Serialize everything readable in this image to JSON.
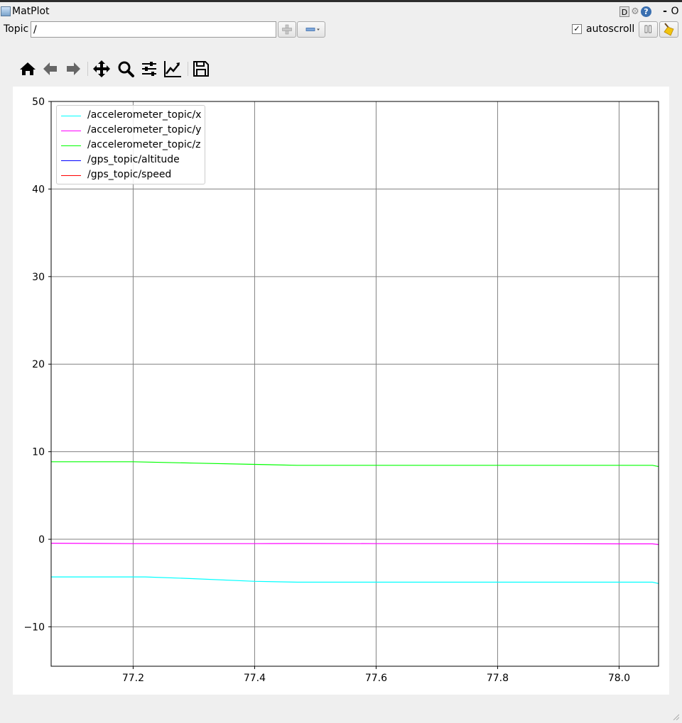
{
  "window": {
    "title": "MatPlot",
    "d_label": "D",
    "help_label": "?",
    "minimize_label": "-",
    "close_label": "O"
  },
  "topic": {
    "label": "Topic",
    "value": "/"
  },
  "autoscroll": {
    "label": "autoscroll",
    "checked": true,
    "check_glyph": "✓"
  },
  "toolbar_icons": [
    "home-icon",
    "back-icon",
    "forward-icon",
    "pan-icon",
    "zoom-icon",
    "configure-subplots-icon",
    "edit-axis-icon",
    "save-icon"
  ],
  "colors": {
    "accelerometer_x": "#00ffff",
    "accelerometer_y": "#ff00ff",
    "accelerometer_z": "#00ff00",
    "gps_altitude": "#0000ff",
    "gps_speed": "#ff0000",
    "grid": "#808080"
  },
  "chart_data": {
    "type": "line",
    "title": "",
    "xlabel": "",
    "ylabel": "",
    "xlim": [
      77.065,
      78.065
    ],
    "ylim": [
      -14.5,
      50
    ],
    "xticks": [
      77.2,
      77.4,
      77.6,
      77.8,
      78.0
    ],
    "xtick_labels": [
      "77.2",
      "77.4",
      "77.6",
      "77.8",
      "78.0"
    ],
    "yticks": [
      -10,
      0,
      10,
      20,
      30,
      40,
      50
    ],
    "ytick_labels": [
      "−10",
      "0",
      "10",
      "20",
      "30",
      "40",
      "50"
    ],
    "grid": true,
    "legend_position": "upper-left",
    "series": [
      {
        "name": "/accelerometer_topic/x",
        "color": "#00ffff",
        "x": [
          77.065,
          77.2,
          77.22,
          77.3,
          77.4,
          77.47,
          77.6,
          77.8,
          78.0,
          78.055,
          78.065
        ],
        "y": [
          -4.3,
          -4.3,
          -4.3,
          -4.5,
          -4.8,
          -4.9,
          -4.9,
          -4.9,
          -4.9,
          -4.9,
          -5.05
        ]
      },
      {
        "name": "/accelerometer_topic/y",
        "color": "#ff00ff",
        "x": [
          77.065,
          77.2,
          77.4,
          77.47,
          77.6,
          77.8,
          78.0,
          78.055,
          78.065
        ],
        "y": [
          -0.45,
          -0.5,
          -0.5,
          -0.48,
          -0.5,
          -0.5,
          -0.52,
          -0.52,
          -0.6
        ]
      },
      {
        "name": "/accelerometer_topic/z",
        "color": "#00ff00",
        "x": [
          77.065,
          77.2,
          77.3,
          77.4,
          77.47,
          77.6,
          77.8,
          78.0,
          78.055,
          78.065
        ],
        "y": [
          8.85,
          8.85,
          8.7,
          8.55,
          8.45,
          8.45,
          8.45,
          8.45,
          8.45,
          8.3
        ]
      },
      {
        "name": "/gps_topic/altitude",
        "color": "#0000ff",
        "x": [],
        "y": []
      },
      {
        "name": "/gps_topic/speed",
        "color": "#ff0000",
        "x": [],
        "y": []
      }
    ]
  }
}
